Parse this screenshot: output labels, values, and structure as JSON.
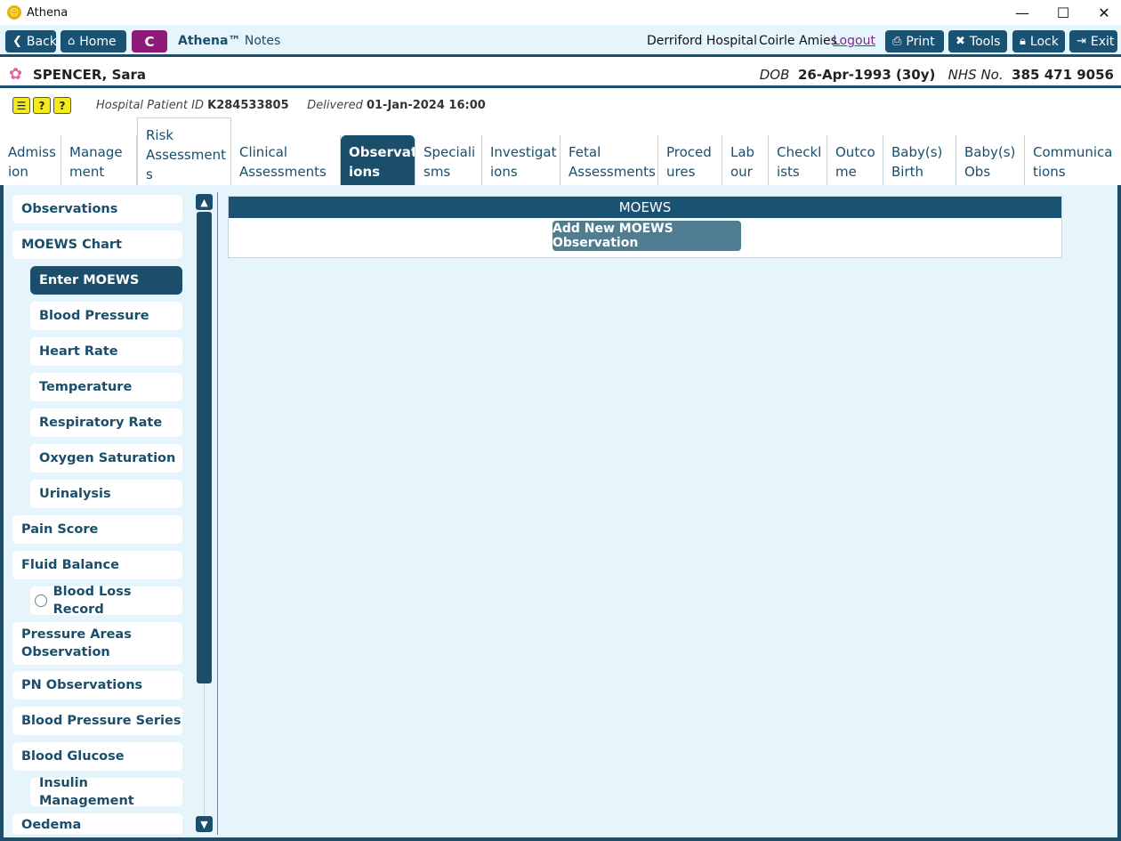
{
  "window": {
    "title": "Athena",
    "minimize_glyph": "—",
    "maximize_glyph": "☐",
    "close_glyph": "✕"
  },
  "toolbar": {
    "back_label": "Back",
    "home_label": "Home",
    "c_label": "C",
    "brand_name": "Athena™",
    "brand_sub": "Notes",
    "hospital": "Derriford Hospital",
    "user": "Coirle Amies",
    "logout_label": "Logout",
    "print_label": "Print",
    "tools_label": "Tools",
    "lock_label": "Lock",
    "exit_label": "Exit"
  },
  "patient": {
    "name": "SPENCER, Sara",
    "dob_label": "DOB",
    "dob_value": "26-Apr-1993 (30y)",
    "nhs_label": "NHS No.",
    "nhs_value": "385 471 9056",
    "hospital_id_label": "Hospital Patient ID",
    "hospital_id_value": "K284533805",
    "delivered_label": "Delivered",
    "delivered_value": "01-Jan-2024 16:00"
  },
  "tabs": [
    {
      "line1": "Admiss",
      "line2": "ion"
    },
    {
      "line1": "Manage",
      "line2": "ment"
    },
    {
      "line1": "Risk",
      "line2": "Assessment",
      "line3": "s"
    },
    {
      "line1": "Clinical",
      "line2": "Assessments"
    },
    {
      "line1": "Observat",
      "line2": "ions"
    },
    {
      "line1": "Speciali",
      "line2": "sms"
    },
    {
      "line1": "Investigat",
      "line2": "ions"
    },
    {
      "line1": "Fetal",
      "line2": "Assessments"
    },
    {
      "line1": "Proced",
      "line2": "ures"
    },
    {
      "line1": "Lab",
      "line2": "our"
    },
    {
      "line1": "Checkl",
      "line2": "ists"
    },
    {
      "line1": "Outco",
      "line2": "me"
    },
    {
      "line1": "Baby(s)",
      "line2": "Birth"
    },
    {
      "line1": "Baby(s)",
      "line2": "Obs"
    },
    {
      "line1": "Communica",
      "line2": "tions"
    }
  ],
  "sidebar": {
    "items": [
      "Observations",
      "MOEWS Chart",
      "Enter MOEWS",
      "Blood Pressure",
      "Heart Rate",
      "Temperature",
      "Respiratory Rate",
      "Oxygen Saturation",
      "Urinalysis",
      "Pain Score",
      "Fluid Balance",
      "Blood Loss Record",
      "Pressure Areas",
      "Observation",
      "PN Observations",
      "Blood Pressure Series",
      "Blood Glucose",
      "Insulin Management",
      "Oedema"
    ]
  },
  "main": {
    "panel_title": "MOEWS",
    "add_button_label": "Add New MOEWS Observation"
  },
  "colors": {
    "primary": "#1a4e6b",
    "background": "#e6f4fb",
    "accent_purple": "#8e1a7a",
    "button_muted": "#4f7d91"
  }
}
